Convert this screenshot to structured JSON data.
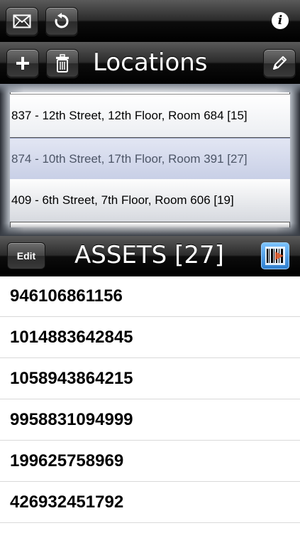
{
  "toolbar": {
    "mail_icon": "mail-icon",
    "refresh_icon": "refresh-icon",
    "info_icon": "info-icon"
  },
  "locations_bar": {
    "title": "Locations",
    "add_icon": "plus-icon",
    "delete_icon": "trash-icon",
    "edit_icon": "pencil-icon"
  },
  "picker": {
    "rows": [
      "837 - 12th Street, 12th Floor, Room 684 [15]",
      "874 - 10th Street, 17th Floor, Room 391 [27]",
      "409 - 6th Street, 7th Floor, Room 606 [19]"
    ],
    "selected_index": 1
  },
  "assets_bar": {
    "edit_label": "Edit",
    "title": "ASSETS [27]",
    "barcode_icon": "barcode-icon"
  },
  "assets": [
    "946106861156",
    "1014883642845",
    "1058943864215",
    "9958831094999",
    "199625758969",
    "426932451792"
  ],
  "colors": {
    "bar_dark": "#000000",
    "selected_row": "#c8cfe6",
    "barcode_accent": "#2e7fd0"
  }
}
